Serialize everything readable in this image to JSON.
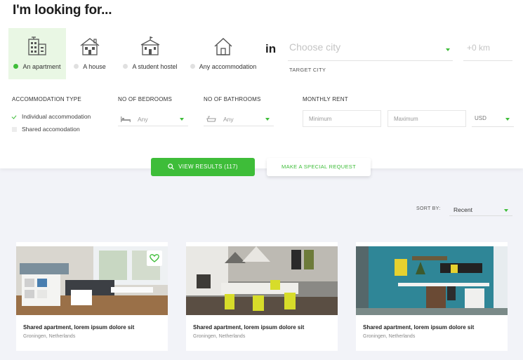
{
  "heading": "I'm looking for...",
  "accommodation_options": [
    {
      "label": "An apartment",
      "icon": "apartment-building-icon",
      "selected": true
    },
    {
      "label": "A house",
      "icon": "house-icon",
      "selected": false
    },
    {
      "label": "A student hostel",
      "icon": "hostel-building-icon",
      "selected": false
    },
    {
      "label": "Any accommodation",
      "icon": "home-outline-icon",
      "selected": false
    }
  ],
  "location": {
    "in_word": "in",
    "city_placeholder": "Choose city",
    "radius_placeholder": "+0 km",
    "target_city_label": "TARGET CITY"
  },
  "filters": {
    "accommodation_type_label": "ACCOMMODATION TYPE",
    "accommodation_types": [
      {
        "label": "Individual accommodation",
        "checked": true
      },
      {
        "label": "Shared accomodation",
        "checked": false
      }
    ],
    "bedrooms_label": "NO OF BEDROOMS",
    "bedrooms_value": "Any",
    "bathrooms_label": "NO OF BATHROOMS",
    "bathrooms_value": "Any",
    "rent_label": "MONTHLY RENT",
    "rent_min_placeholder": "Minimum",
    "rent_max_placeholder": "Maximum",
    "currency": "USD"
  },
  "actions": {
    "view_results": "VIEW RESULTS (117)",
    "special_request": "MAKE A SPECIAL REQUEST"
  },
  "sort": {
    "label": "SORT BY:",
    "value": "Recent"
  },
  "listings": [
    {
      "title": "Shared apartment, lorem ipsum dolore sit",
      "location": "Groningen, Netherlands"
    },
    {
      "title": "Shared apartment, lorem ipsum dolore sit",
      "location": "Groningen, Netherlands"
    },
    {
      "title": "Shared apartment, lorem ipsum dolore sit",
      "location": "Groningen, Netherlands"
    }
  ],
  "colors": {
    "accent": "#3ebd39",
    "selected_bg": "#e9f7e4",
    "page_bg": "#f2f3f8"
  }
}
